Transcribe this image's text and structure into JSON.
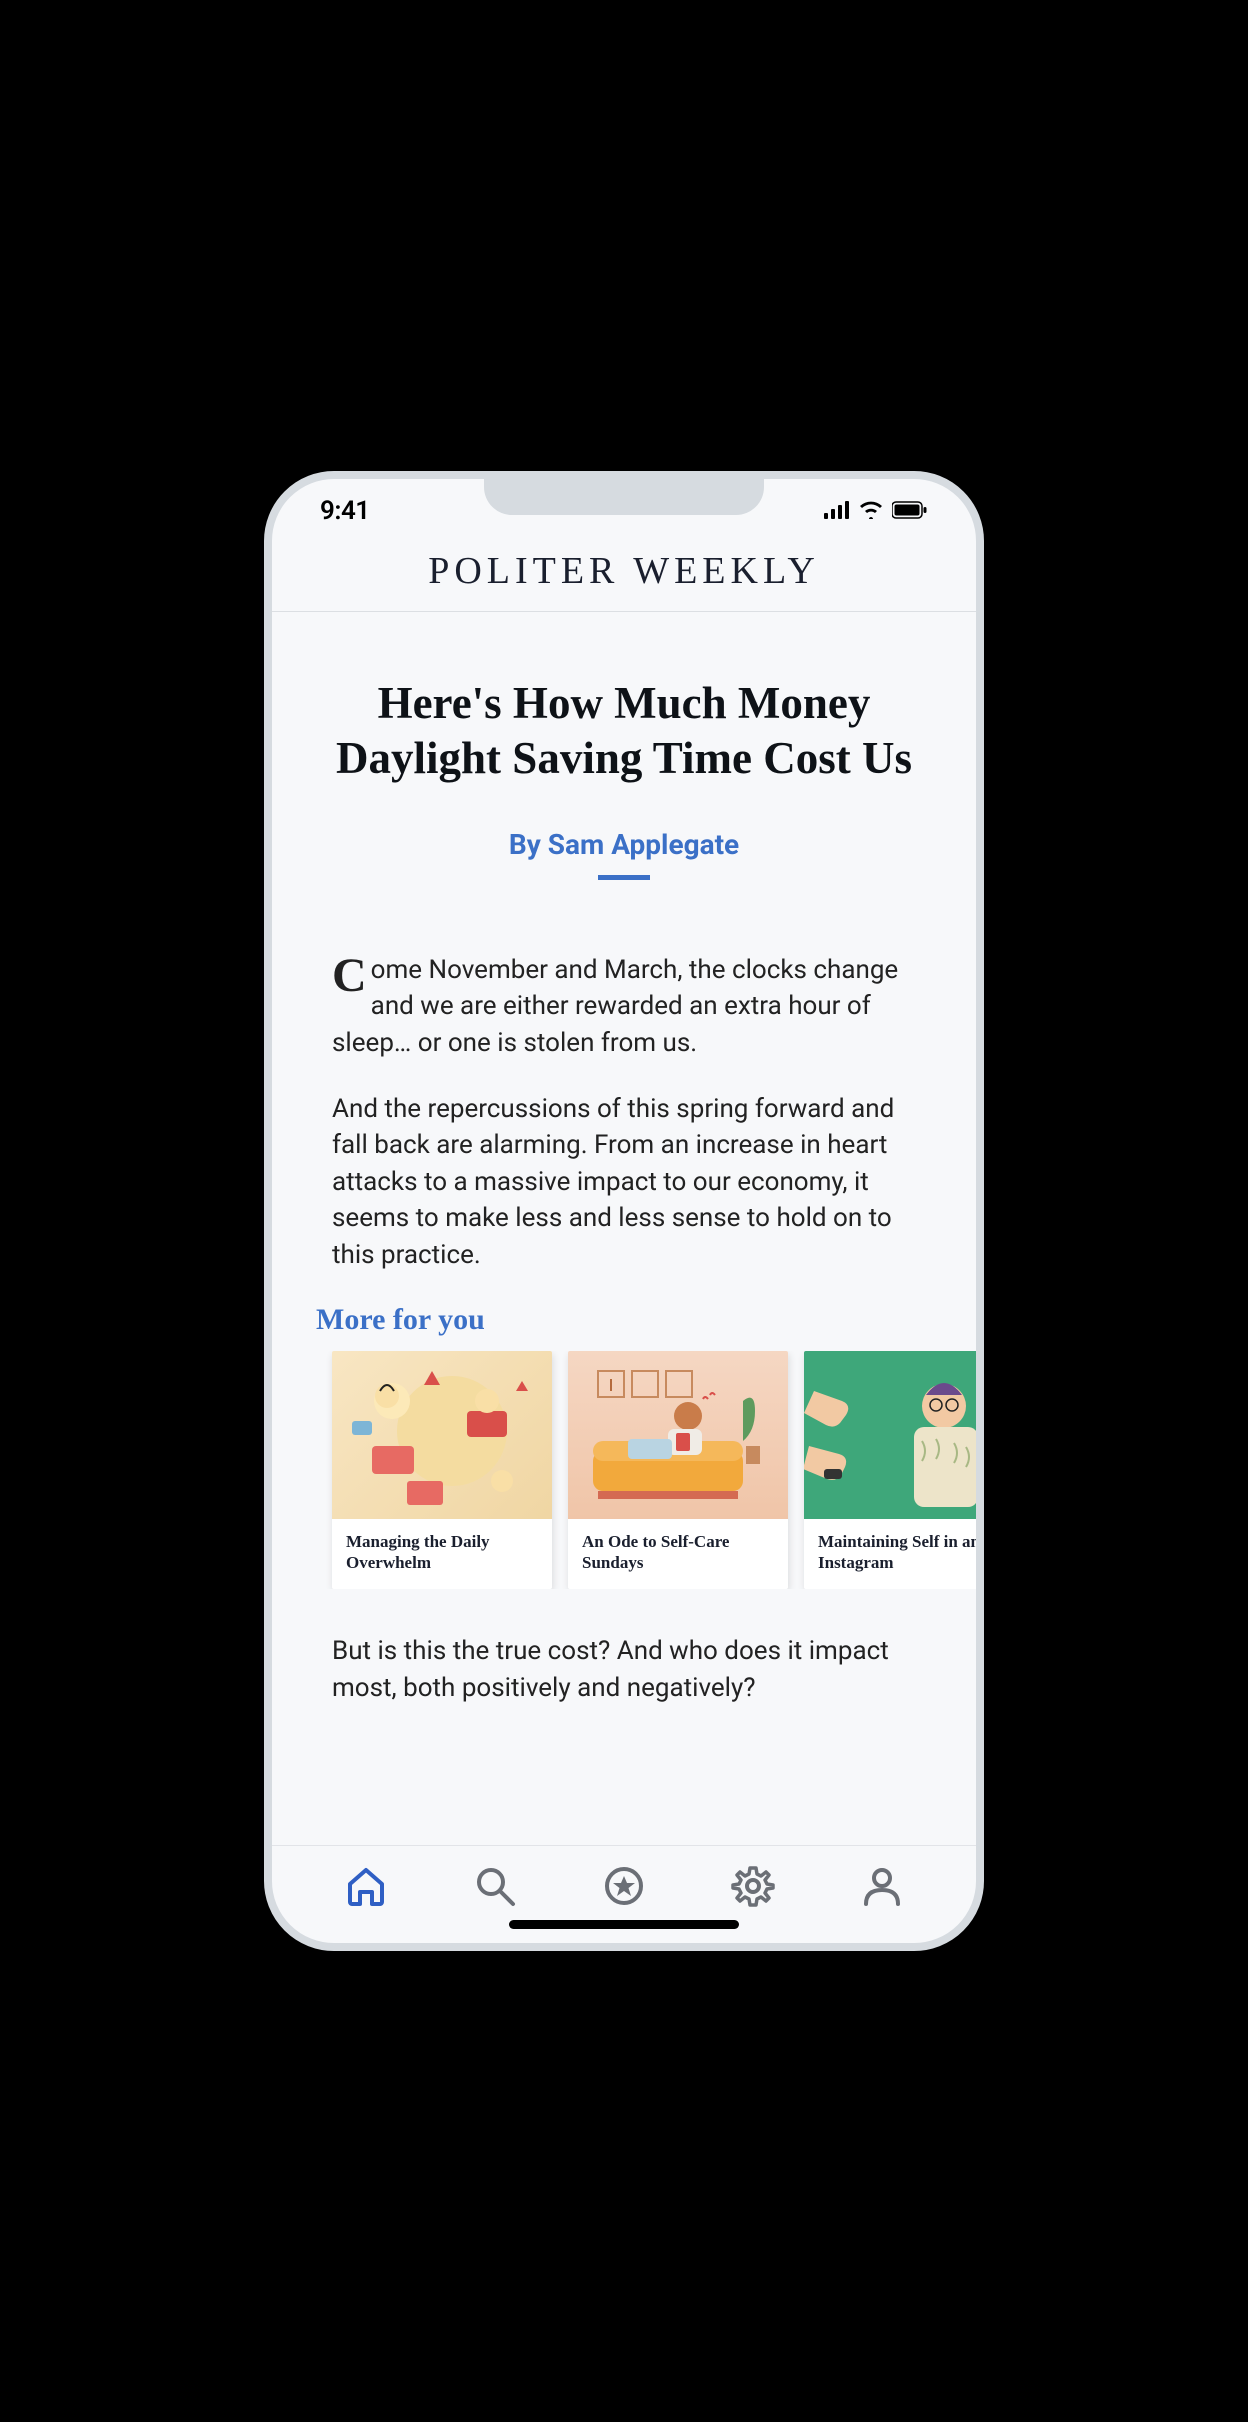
{
  "status": {
    "time": "9:41"
  },
  "brand": "POLITER WEEKLY",
  "article": {
    "title": "Here's How Much Money Daylight Saving Time Cost Us",
    "byline": "By Sam Applegate",
    "para1": "Come November and March, the clocks change and we are either rewarded an extra hour of sleep… or one is stolen from us.",
    "para2": "And the repercussions of this spring forward and fall back are alarming. From an increase in heart attacks to a massive impact to our economy, it seems to make less and less sense to hold on to this practice.",
    "para3": "But is this the true cost? And who does it impact most, both positively and negatively?"
  },
  "more": {
    "heading": "More for you",
    "cards": [
      {
        "title": "Managing the Daily Overwhelm"
      },
      {
        "title": "An Ode to Self-Care Sundays"
      },
      {
        "title": "Maintaining Self in an Instagram "
      }
    ]
  },
  "tabs": {
    "home": "Home",
    "search": "Search",
    "favorites": "Favorites",
    "settings": "Settings",
    "profile": "Profile"
  }
}
